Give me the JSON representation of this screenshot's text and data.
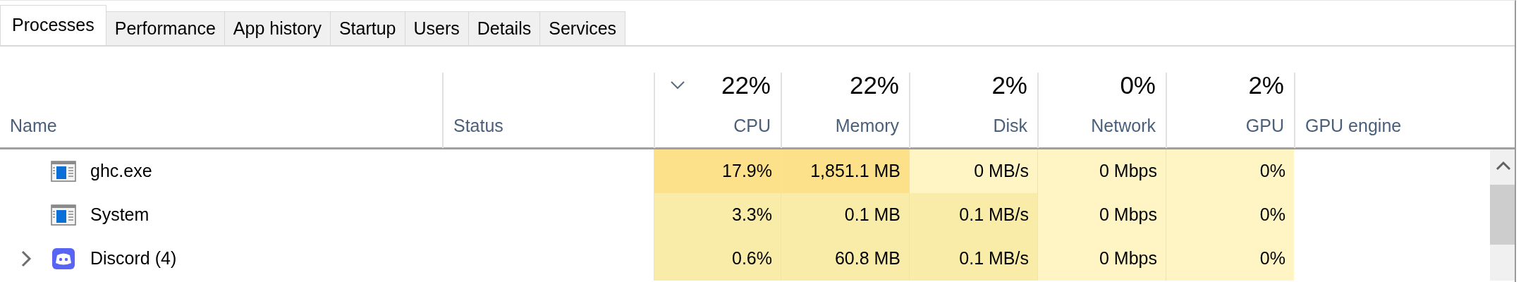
{
  "tabs": [
    {
      "label": "Processes",
      "selected": true
    },
    {
      "label": "Performance",
      "selected": false
    },
    {
      "label": "App history",
      "selected": false
    },
    {
      "label": "Startup",
      "selected": false
    },
    {
      "label": "Users",
      "selected": false
    },
    {
      "label": "Details",
      "selected": false
    },
    {
      "label": "Services",
      "selected": false
    }
  ],
  "columns": [
    {
      "label": "Name",
      "sorted": false
    },
    {
      "label": "Status",
      "sorted": false
    },
    {
      "label": "CPU",
      "total": "22%",
      "sorted": true
    },
    {
      "label": "Memory",
      "total": "22%",
      "sorted": false
    },
    {
      "label": "Disk",
      "total": "2%",
      "sorted": false
    },
    {
      "label": "Network",
      "total": "0%",
      "sorted": false
    },
    {
      "label": "GPU",
      "total": "2%",
      "sorted": false
    },
    {
      "label": "GPU engine",
      "sorted": false
    }
  ],
  "rows": [
    {
      "kind": "process",
      "name": "ghc.exe",
      "cells": [
        {
          "text": "17.9%",
          "color": "#fce18a"
        },
        {
          "text": "1,851.1 MB",
          "color": "#fce18a"
        },
        {
          "text": "0 MB/s",
          "color": "#fff4c4"
        },
        {
          "text": "0 Mbps",
          "color": "#fff4c4"
        },
        {
          "text": "0%",
          "color": "#fff4c4"
        }
      ]
    },
    {
      "kind": "process",
      "name": "System",
      "cells": [
        {
          "text": "3.3%",
          "color": "#f9eba8"
        },
        {
          "text": "0.1 MB",
          "color": "#f9eba8"
        },
        {
          "text": "0.1 MB/s",
          "color": "#f9eba8"
        },
        {
          "text": "0 Mbps",
          "color": "#fff4c4"
        },
        {
          "text": "0%",
          "color": "#fff4c4"
        }
      ]
    },
    {
      "kind": "group",
      "name": "Discord (4)",
      "expanded": false,
      "cells": [
        {
          "text": "0.6%",
          "color": "#f9eba8"
        },
        {
          "text": "60.8 MB",
          "color": "#f9eba8"
        },
        {
          "text": "0.1 MB/s",
          "color": "#f9eba8"
        },
        {
          "text": "0 Mbps",
          "color": "#fff4c4"
        },
        {
          "text": "0%",
          "color": "#fff4c4"
        }
      ]
    }
  ]
}
